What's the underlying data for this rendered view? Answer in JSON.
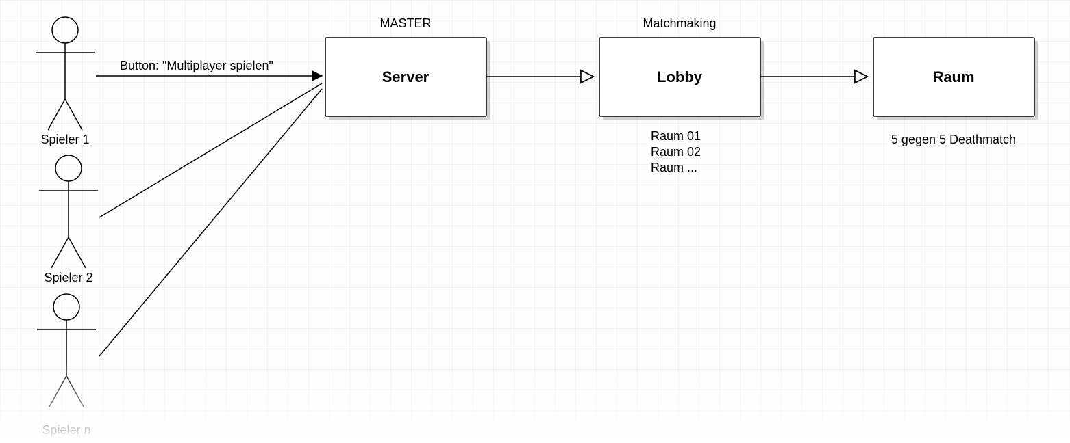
{
  "actors": {
    "a1": "Spieler 1",
    "a2": "Spieler 2",
    "a3": "Spieler n"
  },
  "edge_label": "Button: \"Multiplayer spielen\"",
  "nodes": {
    "server": {
      "top": "MASTER",
      "label": "Server"
    },
    "lobby": {
      "top": "Matchmaking",
      "label": "Lobby",
      "below1": "Raum 01",
      "below2": "Raum 02",
      "below3": "Raum ..."
    },
    "raum": {
      "label": "Raum",
      "below": "5 gegen 5 Deathmatch"
    }
  }
}
